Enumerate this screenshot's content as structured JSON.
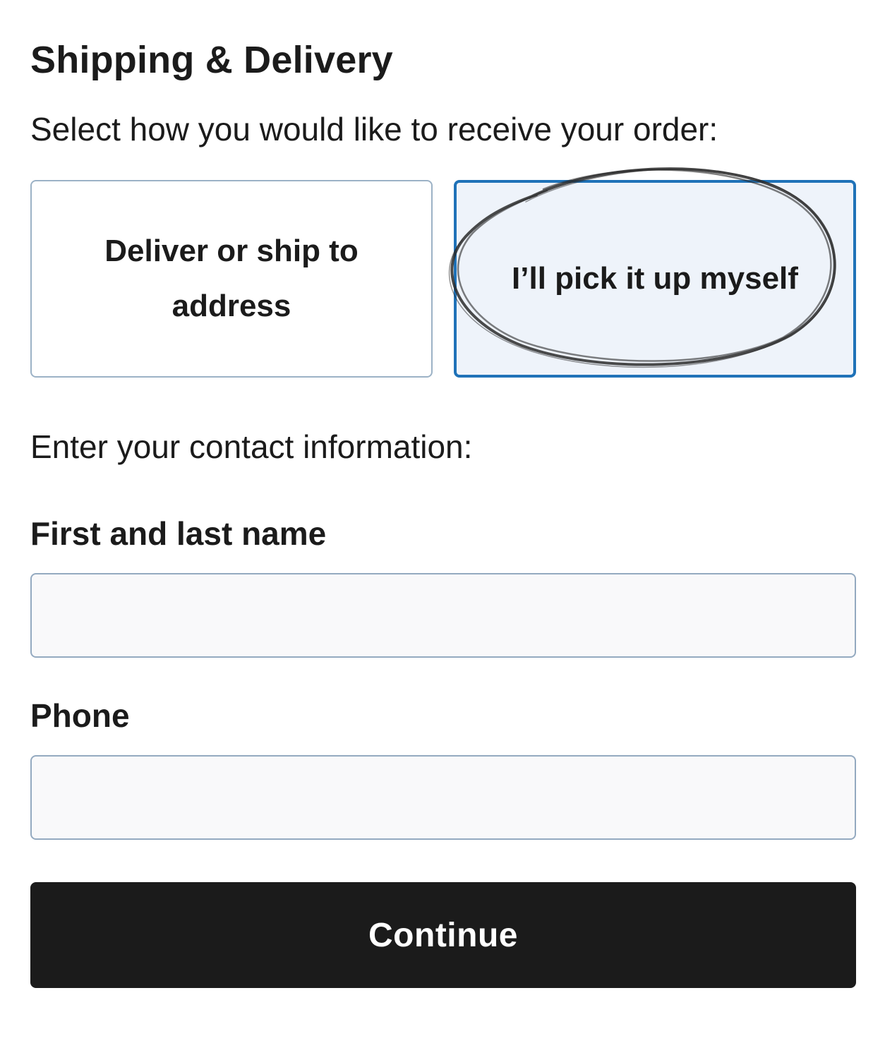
{
  "page": {
    "title": "Shipping & Delivery",
    "instruction": "Select how you would like to receive your order:"
  },
  "delivery_options": [
    {
      "label": "Deliver or ship to address",
      "selected": false
    },
    {
      "label": "I’ll pick it up myself",
      "selected": true,
      "annotated": "hand-drawn circle"
    }
  ],
  "contact": {
    "heading": "Enter your contact information:",
    "name_label": "First and last name",
    "name_value": "",
    "phone_label": "Phone",
    "phone_value": ""
  },
  "actions": {
    "continue_label": "Continue"
  },
  "colors": {
    "selected_border": "#1f72b8",
    "selected_background": "#eef3fa",
    "button_background": "#1b1b1b",
    "input_border": "#94aac0"
  },
  "icons": [
    "pencil-circle-annotation"
  ]
}
